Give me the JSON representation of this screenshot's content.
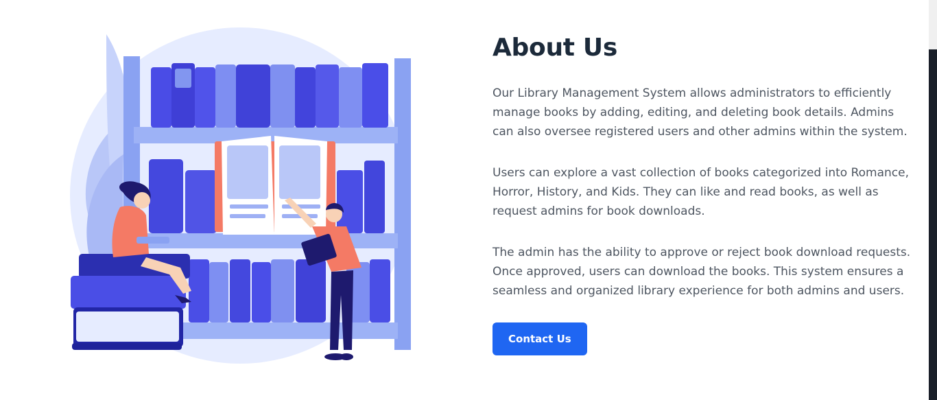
{
  "about": {
    "title": "About Us",
    "paragraphs": [
      "Our Library Management System allows administrators to efficiently manage books by adding, editing, and deleting book details. Admins can also oversee registered users and other admins within the system.",
      "Users can explore a vast collection of books categorized into Romance, Horror, History, and Kids. They can like and read books, as well as request admins for book downloads.",
      "The admin has the ability to approve or reject book download requests. Once approved, users can download the books. This system ensures a seamless and organized library experience for both admins and users."
    ],
    "button_label": "Contact Us"
  },
  "colors": {
    "accent": "#1f66f2",
    "heading": "#1c2a3a",
    "body_text": "#4d5560"
  }
}
